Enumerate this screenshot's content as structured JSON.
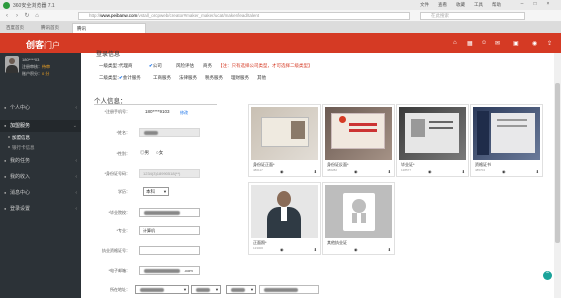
{
  "browser": {
    "title": "360安全浏览器 7.1",
    "menu": [
      "文件",
      "查看",
      "收藏",
      "工具",
      "帮助"
    ],
    "url_prefix": "http://",
    "url_domain": "www.peibanw.com",
    "url_path": "/vstall_orcpweb/creator#maker_maker/ucat/maker/lead/talent",
    "search_placeholder": "在此搜索",
    "tabs": [
      "百度首页",
      "腾讯首页",
      "腾讯"
    ]
  },
  "sidebar": {
    "brand_main": "创客",
    "brand_sub": "门户",
    "user_id": "180****03",
    "user_status_label": "注册审核：",
    "user_status_value": "待审",
    "balance_label": "账户积分：",
    "balance_value": "0 分",
    "items": [
      {
        "label": "个人中心",
        "icon": "person-icon"
      },
      {
        "label": "加盟服务",
        "icon": "handshake-icon",
        "active": true
      },
      {
        "label": "我的任务",
        "icon": "task-icon"
      },
      {
        "label": "我的收入",
        "icon": "money-icon"
      },
      {
        "label": "消息中心",
        "icon": "bell-icon"
      },
      {
        "label": "登录设置",
        "icon": "gear-icon"
      }
    ],
    "subitems": [
      "加盟信息",
      "银行卡信息"
    ]
  },
  "form": {
    "top_heading": "登录信息",
    "type1_label": "一级类型：",
    "type1_options": [
      "代理商",
      "公司",
      "风险评估",
      "商务"
    ],
    "type1_note": "【注：只有选择公司类型，才可选择二级类型】",
    "type2_label": "二级类型：",
    "type2_options": [
      "会计服务",
      "工商服务",
      "法律服务",
      "税务服务",
      "理财服务",
      "其他"
    ],
    "section_title": "个人信息：",
    "fields": {
      "phone_label": "*注册手机号：",
      "phone_value": "180****9103",
      "phone_link": "修改",
      "name_label": "*姓名：",
      "gender_label": "*性别：",
      "gender_male": "男",
      "gender_female": "女",
      "idcard_label": "*身份证号码：",
      "idcard_value": "1234(3)18990518(**)",
      "education_label": "学历：",
      "education_value": "本科",
      "school_label": "*毕业院校：",
      "major_label": "*专业：",
      "major_value": "计算机",
      "qualification_label": "执业资格证号：",
      "email_label": "*电子邮箱：",
      "email_suffix": ".com",
      "address_label": "所在地址："
    }
  },
  "cards": [
    {
      "label": "身份证正面*",
      "sub": "486117"
    },
    {
      "label": "身份证反面*",
      "sub": "486282"
    },
    {
      "label": "毕业证*",
      "sub": "128577"
    },
    {
      "label": "资格证书",
      "sub": "485704"
    },
    {
      "label": "正面照*",
      "sub": "123006"
    },
    {
      "label": "其他执业证",
      "sub": ""
    }
  ]
}
